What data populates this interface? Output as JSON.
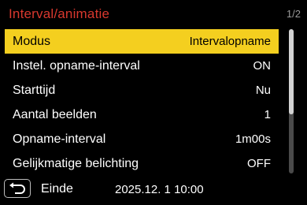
{
  "header": {
    "title": "Interval/animatie",
    "page": "1/2"
  },
  "menu": {
    "items": [
      {
        "label": "Modus",
        "value": "Intervalopname",
        "selected": true
      },
      {
        "label": "Instel. opname-interval",
        "value": "ON"
      },
      {
        "label": "Starttijd",
        "value": "Nu"
      },
      {
        "label": "Aantal beelden",
        "value": "1"
      },
      {
        "label": "Opname-interval",
        "value": "1m00s"
      },
      {
        "label": "Gelijkmatige belichting",
        "value": "OFF"
      }
    ]
  },
  "footer": {
    "back_icon": "return-arrow-icon",
    "back_label": "Einde",
    "datetime": "2025.12. 1 10:00"
  },
  "colors": {
    "title": "#d8382e",
    "highlight": "#f4cf1f",
    "background": "#000000"
  }
}
